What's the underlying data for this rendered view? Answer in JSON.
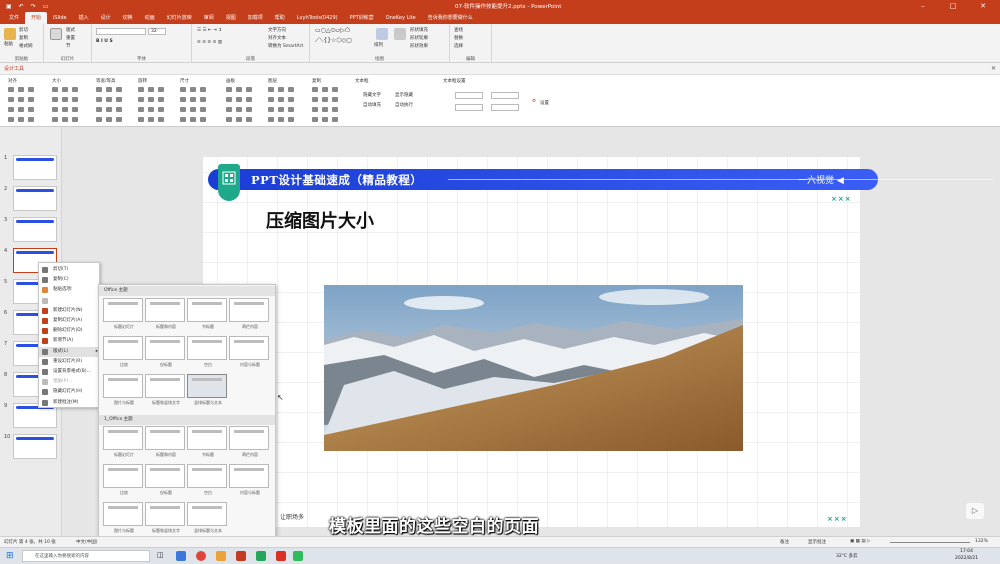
{
  "window": {
    "title": "07-软件操作技能提升2.pptx - PowerPoint"
  },
  "tabs": [
    "文件",
    "开始",
    "iSlide",
    "插入",
    "设计",
    "切换",
    "动画",
    "幻灯片放映",
    "审阅",
    "视图",
    "加载项",
    "帮助",
    "LvyhTools(0429)",
    "PPT训练营",
    "OneKey Lite"
  ],
  "tell_me": "告诉我你想要做什么",
  "ribbon": {
    "clipboard": {
      "label": "剪贴板",
      "paste": "粘贴",
      "cut": "剪切",
      "copy": "复制",
      "format": "格式刷"
    },
    "slides": {
      "label": "幻灯片",
      "new": "新建\n幻灯片",
      "layout": "版式",
      "reset": "重置",
      "section": "节"
    },
    "font": {
      "label": "字体",
      "size": "32"
    },
    "paragraph": {
      "label": "段落",
      "text_dir": "文字方向",
      "align": "对齐文本",
      "smartart": "转换为 SmartArt"
    },
    "drawing": {
      "label": "绘图",
      "arrange": "排列",
      "quick": "快速样式",
      "fill": "形状填充",
      "outline": "形状轮廓",
      "effect": "形状效果"
    },
    "editing": {
      "label": "编辑",
      "find": "查找",
      "replace": "替换",
      "select": "选择"
    }
  },
  "design_tools": {
    "label": "设计工具"
  },
  "panel_groups": [
    "对齐",
    "大小",
    "等宽/等高",
    "旋转",
    "尺寸",
    "画板",
    "图层",
    "复制",
    "文本框",
    "文本框设置"
  ],
  "panel_text": {
    "hide_text": "隐藏文字",
    "show_text": "显示隐藏",
    "auto": "自动填充",
    "auto2": "自动执行",
    "settings": "设置"
  },
  "slides": [
    {
      "n": "1"
    },
    {
      "n": "2"
    },
    {
      "n": "3"
    },
    {
      "n": "4"
    },
    {
      "n": "5"
    },
    {
      "n": "6"
    },
    {
      "n": "7"
    },
    {
      "n": "8"
    },
    {
      "n": "9"
    },
    {
      "n": "10"
    }
  ],
  "context_menu": [
    {
      "label": "剪切(T)",
      "dim": false
    },
    {
      "label": "复制(C)",
      "dim": false
    },
    {
      "label": "粘贴选项:",
      "dim": false
    },
    {
      "label": "",
      "dim": false
    },
    {
      "label": "新建幻灯片(N)",
      "dim": false
    },
    {
      "label": "复制幻灯片(A)",
      "dim": false
    },
    {
      "label": "删除幻灯片(D)",
      "dim": false
    },
    {
      "label": "新增节(A)",
      "dim": false
    },
    {
      "label": "版式(L)",
      "dim": false
    },
    {
      "label": "重设幻灯片(R)",
      "dim": false
    },
    {
      "label": "设置背景格式(B)...",
      "dim": false
    },
    {
      "label": "相册(P)...",
      "dim": true
    },
    {
      "label": "隐藏幻灯片(H)",
      "dim": false
    },
    {
      "label": "新建批注(M)",
      "dim": false
    }
  ],
  "layouts": {
    "section1": "Office 主题",
    "section2": "1_Office 主题",
    "names": [
      "标题幻灯片",
      "标题和内容",
      "节标题",
      "两栏内容",
      "比较",
      "仅标题",
      "空白",
      "内容与标题",
      "图片与标题",
      "标题和竖排文字",
      "竖排标题与文本"
    ]
  },
  "slide": {
    "banner_title": "PPT设计基础速成（精品教程）",
    "banner_right": "一六视觉",
    "title": "压缩图片大小",
    "marks": "×××",
    "left_fragment": "、让职场多"
  },
  "subtitle": "模板里面的这些空白的页面",
  "status": {
    "slide_info": "幻灯片 第 4 张，共 10 张",
    "lang": "中文(中国)",
    "notes": "备注",
    "comments": "显示批注",
    "zoom": "132%"
  },
  "taskbar": {
    "search": "在这里输入你要搜索的内容",
    "weather": "32°C 多云",
    "time": "17:04",
    "date": "2022/8/21"
  }
}
